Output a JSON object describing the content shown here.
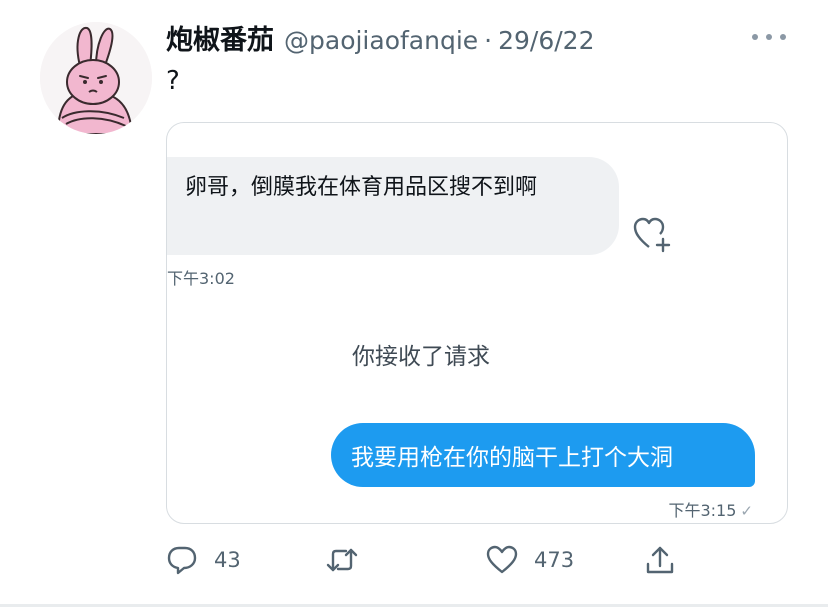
{
  "tweet": {
    "display_name": "炮椒番茄",
    "handle": "@paojiaofanqie",
    "separator": "·",
    "date": "29/6/22",
    "text": "?"
  },
  "embedded": {
    "incoming_message": "卵哥，倒膜我在体育用品区搜不到啊",
    "incoming_time": "下午3:02",
    "system_message": "你接收了请求",
    "outgoing_message": "我要用枪在你的脑干上打个大洞",
    "outgoing_time": "下午3:15",
    "read_receipt": "✓"
  },
  "actions": {
    "reply_count": "43",
    "like_count": "473"
  },
  "icons": {
    "avatar": "pink-rabbit-avatar",
    "more": "more-icon",
    "reply": "reply-icon",
    "retweet": "retweet-icon",
    "like": "like-icon",
    "share": "share-icon",
    "react": "heart-plus-icon"
  },
  "colors": {
    "accent": "#1d9bf0",
    "secondary_text": "#536471",
    "bubble_gray": "#eff1f3"
  }
}
